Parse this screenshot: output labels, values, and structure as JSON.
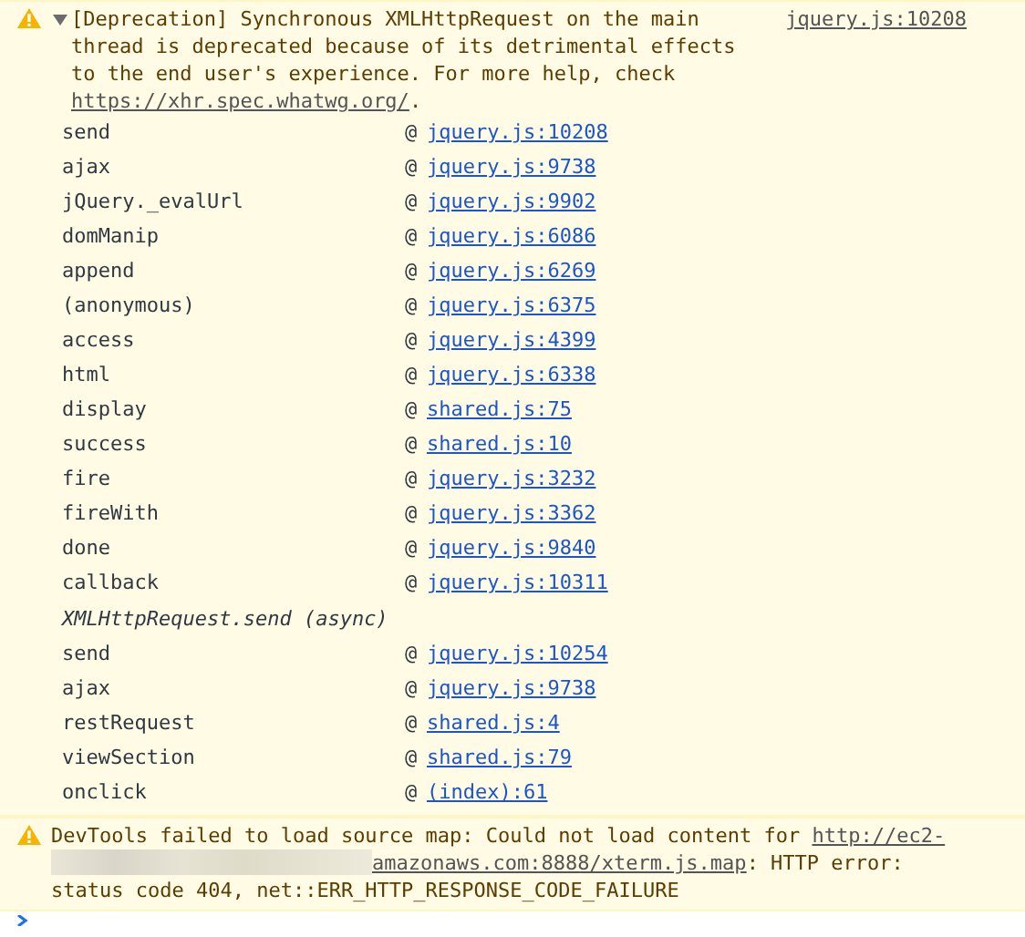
{
  "messages": [
    {
      "kind": "warning",
      "expanded": true,
      "source": "jquery.js:10208",
      "text_before": "[Deprecation] Synchronous XMLHttpRequest on the main thread is deprecated because of its detrimental effects to the end user's experience. For more help, check ",
      "link": "https://xhr.spec.whatwg.org/",
      "text_after": ".",
      "stack": [
        {
          "kind": "frame",
          "function": "send",
          "at": "@",
          "location": "jquery.js:10208"
        },
        {
          "kind": "frame",
          "function": "ajax",
          "at": "@",
          "location": "jquery.js:9738"
        },
        {
          "kind": "frame",
          "function": "jQuery._evalUrl",
          "at": "@",
          "location": "jquery.js:9902"
        },
        {
          "kind": "frame",
          "function": "domManip",
          "at": "@",
          "location": "jquery.js:6086"
        },
        {
          "kind": "frame",
          "function": "append",
          "at": "@",
          "location": "jquery.js:6269"
        },
        {
          "kind": "frame",
          "function": "(anonymous)",
          "at": "@",
          "location": "jquery.js:6375"
        },
        {
          "kind": "frame",
          "function": "access",
          "at": "@",
          "location": "jquery.js:4399"
        },
        {
          "kind": "frame",
          "function": "html",
          "at": "@",
          "location": "jquery.js:6338"
        },
        {
          "kind": "frame",
          "function": "display",
          "at": "@",
          "location": "shared.js:75"
        },
        {
          "kind": "frame",
          "function": "success",
          "at": "@",
          "location": "shared.js:10"
        },
        {
          "kind": "frame",
          "function": "fire",
          "at": "@",
          "location": "jquery.js:3232"
        },
        {
          "kind": "frame",
          "function": "fireWith",
          "at": "@",
          "location": "jquery.js:3362"
        },
        {
          "kind": "frame",
          "function": "done",
          "at": "@",
          "location": "jquery.js:9840"
        },
        {
          "kind": "frame",
          "function": "callback",
          "at": "@",
          "location": "jquery.js:10311"
        },
        {
          "kind": "async",
          "function": "XMLHttpRequest.send (async)"
        },
        {
          "kind": "frame",
          "function": "send",
          "at": "@",
          "location": "jquery.js:10254"
        },
        {
          "kind": "frame",
          "function": "ajax",
          "at": "@",
          "location": "jquery.js:9738"
        },
        {
          "kind": "frame",
          "function": "restRequest",
          "at": "@",
          "location": "shared.js:4"
        },
        {
          "kind": "frame",
          "function": "viewSection",
          "at": "@",
          "location": "shared.js:79"
        },
        {
          "kind": "frame",
          "function": "onclick",
          "at": "@",
          "location": "(index):61"
        }
      ]
    },
    {
      "kind": "warning",
      "text_before": "DevTools failed to load source map: Could not load content for ",
      "link_parts": [
        "http://ec2-",
        "amazonaws.com:8888/xterm.js.map"
      ],
      "text_after": ": HTTP error: status code 404, net::ERR_HTTP_RESPONSE_CODE_FAILURE"
    }
  ]
}
